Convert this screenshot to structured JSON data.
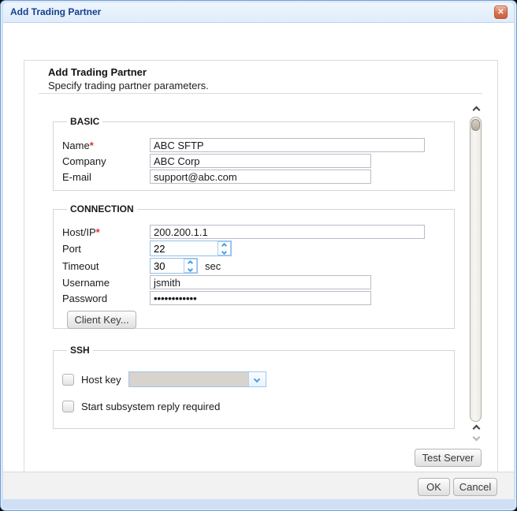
{
  "window": {
    "title": "Add Trading Partner",
    "close_glyph": "✕"
  },
  "header": {
    "title": "Add Trading Partner",
    "subtitle": "Specify trading partner parameters."
  },
  "basic": {
    "legend": "BASIC",
    "name_label": "Name",
    "required_marker": "*",
    "name_value": "ABC SFTP",
    "company_label": "Company",
    "company_value": "ABC Corp",
    "email_label": "E-mail",
    "email_value": "support@abc.com"
  },
  "connection": {
    "legend": "CONNECTION",
    "host_label": "Host/IP",
    "required_marker": "*",
    "host_value": "200.200.1.1",
    "port_label": "Port",
    "port_value": "22",
    "timeout_label": "Timeout",
    "timeout_value": "30",
    "timeout_unit": "sec",
    "username_label": "Username",
    "username_value": "jsmith",
    "password_label": "Password",
    "password_value": "••••••••••••",
    "client_key_button": "Client Key..."
  },
  "ssh": {
    "legend": "SSH",
    "host_key_label": "Host key",
    "host_key_selected": "",
    "start_subsystem_label": "Start subsystem reply required"
  },
  "actions": {
    "test_server": "Test Server",
    "ok": "OK",
    "cancel": "Cancel"
  },
  "colors": {
    "title_blue": "#15428b",
    "spinner_blue": "#41a0e8",
    "required_red": "#e03030",
    "close_orange": "#d5714d",
    "footer_gray": "#f2f2f2",
    "dropdown_disabled": "#d8d3cc"
  }
}
